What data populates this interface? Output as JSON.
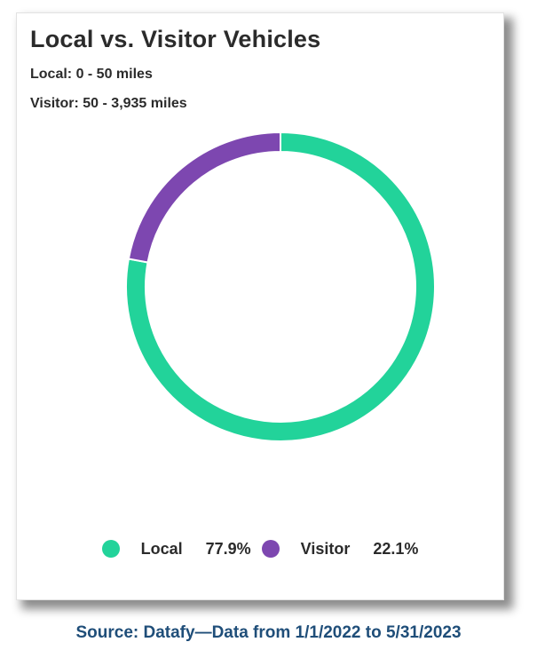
{
  "chart_data": {
    "type": "pie",
    "donut": true,
    "title": "Local vs. Visitor Vehicles",
    "subtitles": [
      "Local: 0 - 50 miles",
      "Visitor: 50 - 3,935 miles"
    ],
    "slices": [
      {
        "label": "Local",
        "value": 77.9,
        "display": "77.9%",
        "color": "#22d39a"
      },
      {
        "label": "Visitor",
        "value": 22.1,
        "display": "22.1%",
        "color": "#7d47b0"
      }
    ],
    "legend_position": "bottom"
  },
  "source": "Source: Datafy—Data from 1/1/2022 to 5/31/2023"
}
